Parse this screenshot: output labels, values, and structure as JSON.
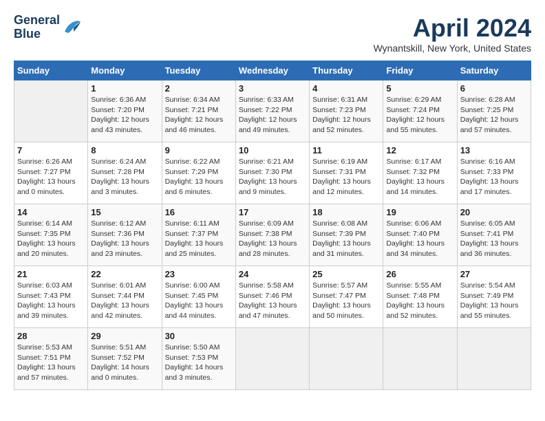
{
  "header": {
    "logo_line1": "General",
    "logo_line2": "Blue",
    "title": "April 2024",
    "location": "Wynantskill, New York, United States"
  },
  "calendar": {
    "days_of_week": [
      "Sunday",
      "Monday",
      "Tuesday",
      "Wednesday",
      "Thursday",
      "Friday",
      "Saturday"
    ],
    "weeks": [
      [
        {
          "day": "",
          "info": ""
        },
        {
          "day": "1",
          "info": "Sunrise: 6:36 AM\nSunset: 7:20 PM\nDaylight: 12 hours\nand 43 minutes."
        },
        {
          "day": "2",
          "info": "Sunrise: 6:34 AM\nSunset: 7:21 PM\nDaylight: 12 hours\nand 46 minutes."
        },
        {
          "day": "3",
          "info": "Sunrise: 6:33 AM\nSunset: 7:22 PM\nDaylight: 12 hours\nand 49 minutes."
        },
        {
          "day": "4",
          "info": "Sunrise: 6:31 AM\nSunset: 7:23 PM\nDaylight: 12 hours\nand 52 minutes."
        },
        {
          "day": "5",
          "info": "Sunrise: 6:29 AM\nSunset: 7:24 PM\nDaylight: 12 hours\nand 55 minutes."
        },
        {
          "day": "6",
          "info": "Sunrise: 6:28 AM\nSunset: 7:25 PM\nDaylight: 12 hours\nand 57 minutes."
        }
      ],
      [
        {
          "day": "7",
          "info": "Sunrise: 6:26 AM\nSunset: 7:27 PM\nDaylight: 13 hours\nand 0 minutes."
        },
        {
          "day": "8",
          "info": "Sunrise: 6:24 AM\nSunset: 7:28 PM\nDaylight: 13 hours\nand 3 minutes."
        },
        {
          "day": "9",
          "info": "Sunrise: 6:22 AM\nSunset: 7:29 PM\nDaylight: 13 hours\nand 6 minutes."
        },
        {
          "day": "10",
          "info": "Sunrise: 6:21 AM\nSunset: 7:30 PM\nDaylight: 13 hours\nand 9 minutes."
        },
        {
          "day": "11",
          "info": "Sunrise: 6:19 AM\nSunset: 7:31 PM\nDaylight: 13 hours\nand 12 minutes."
        },
        {
          "day": "12",
          "info": "Sunrise: 6:17 AM\nSunset: 7:32 PM\nDaylight: 13 hours\nand 14 minutes."
        },
        {
          "day": "13",
          "info": "Sunrise: 6:16 AM\nSunset: 7:33 PM\nDaylight: 13 hours\nand 17 minutes."
        }
      ],
      [
        {
          "day": "14",
          "info": "Sunrise: 6:14 AM\nSunset: 7:35 PM\nDaylight: 13 hours\nand 20 minutes."
        },
        {
          "day": "15",
          "info": "Sunrise: 6:12 AM\nSunset: 7:36 PM\nDaylight: 13 hours\nand 23 minutes."
        },
        {
          "day": "16",
          "info": "Sunrise: 6:11 AM\nSunset: 7:37 PM\nDaylight: 13 hours\nand 25 minutes."
        },
        {
          "day": "17",
          "info": "Sunrise: 6:09 AM\nSunset: 7:38 PM\nDaylight: 13 hours\nand 28 minutes."
        },
        {
          "day": "18",
          "info": "Sunrise: 6:08 AM\nSunset: 7:39 PM\nDaylight: 13 hours\nand 31 minutes."
        },
        {
          "day": "19",
          "info": "Sunrise: 6:06 AM\nSunset: 7:40 PM\nDaylight: 13 hours\nand 34 minutes."
        },
        {
          "day": "20",
          "info": "Sunrise: 6:05 AM\nSunset: 7:41 PM\nDaylight: 13 hours\nand 36 minutes."
        }
      ],
      [
        {
          "day": "21",
          "info": "Sunrise: 6:03 AM\nSunset: 7:43 PM\nDaylight: 13 hours\nand 39 minutes."
        },
        {
          "day": "22",
          "info": "Sunrise: 6:01 AM\nSunset: 7:44 PM\nDaylight: 13 hours\nand 42 minutes."
        },
        {
          "day": "23",
          "info": "Sunrise: 6:00 AM\nSunset: 7:45 PM\nDaylight: 13 hours\nand 44 minutes."
        },
        {
          "day": "24",
          "info": "Sunrise: 5:58 AM\nSunset: 7:46 PM\nDaylight: 13 hours\nand 47 minutes."
        },
        {
          "day": "25",
          "info": "Sunrise: 5:57 AM\nSunset: 7:47 PM\nDaylight: 13 hours\nand 50 minutes."
        },
        {
          "day": "26",
          "info": "Sunrise: 5:55 AM\nSunset: 7:48 PM\nDaylight: 13 hours\nand 52 minutes."
        },
        {
          "day": "27",
          "info": "Sunrise: 5:54 AM\nSunset: 7:49 PM\nDaylight: 13 hours\nand 55 minutes."
        }
      ],
      [
        {
          "day": "28",
          "info": "Sunrise: 5:53 AM\nSunset: 7:51 PM\nDaylight: 13 hours\nand 57 minutes."
        },
        {
          "day": "29",
          "info": "Sunrise: 5:51 AM\nSunset: 7:52 PM\nDaylight: 14 hours\nand 0 minutes."
        },
        {
          "day": "30",
          "info": "Sunrise: 5:50 AM\nSunset: 7:53 PM\nDaylight: 14 hours\nand 3 minutes."
        },
        {
          "day": "",
          "info": ""
        },
        {
          "day": "",
          "info": ""
        },
        {
          "day": "",
          "info": ""
        },
        {
          "day": "",
          "info": ""
        }
      ]
    ]
  }
}
